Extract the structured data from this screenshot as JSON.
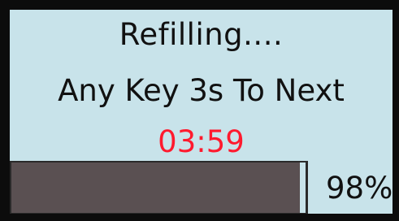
{
  "status": {
    "title": "Refilling....",
    "instruction": "Any Key 3s To Next",
    "countdown": "03:59"
  },
  "progress": {
    "fraction": 0.98,
    "label": "98%"
  },
  "colors": {
    "panel_background": "#c8e3ea",
    "frame": "#0c0c0c",
    "countdown_text": "#ff1a2e",
    "progress_fill": "#5a5052"
  }
}
